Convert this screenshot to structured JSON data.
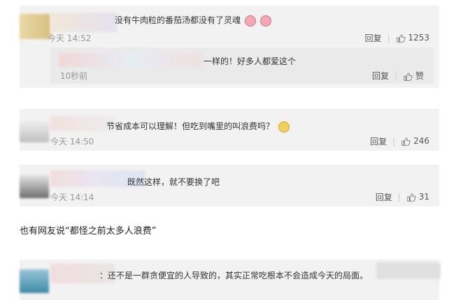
{
  "comments": [
    {
      "text": "没有牛肉粒的番茄汤都没有了灵魂",
      "time": "今天 14:52",
      "reply_label": "回复",
      "like_count": "1253"
    },
    {
      "text": "节省成本可以理解！但吃到嘴里的叫浪费吗？",
      "time": "今天 14:50",
      "reply_label": "回复",
      "like_count": "246"
    },
    {
      "text": "既然这样，就不要换了吧",
      "time": "今天 14:14",
      "reply_label": "回复",
      "like_count": "31"
    },
    {
      "text": "：还不是一群贪便宜的人导致的，其实正常吃根本不会造成今天的局面。"
    }
  ],
  "nested_reply": {
    "text": "一样的！好多人都爱这个",
    "time": "10秒前",
    "reply_label": "回复",
    "like_label": "赞"
  },
  "section_text": "也有网友说“都怪之前太多人浪费”",
  "icons": {
    "like": "thumbs-up-icon",
    "emoji": "laughing-crying-emoji-icon"
  },
  "colors": {
    "card_bg": "#f2f2f2",
    "reply_bg": "#eaeaea",
    "muted_text": "#999999"
  }
}
